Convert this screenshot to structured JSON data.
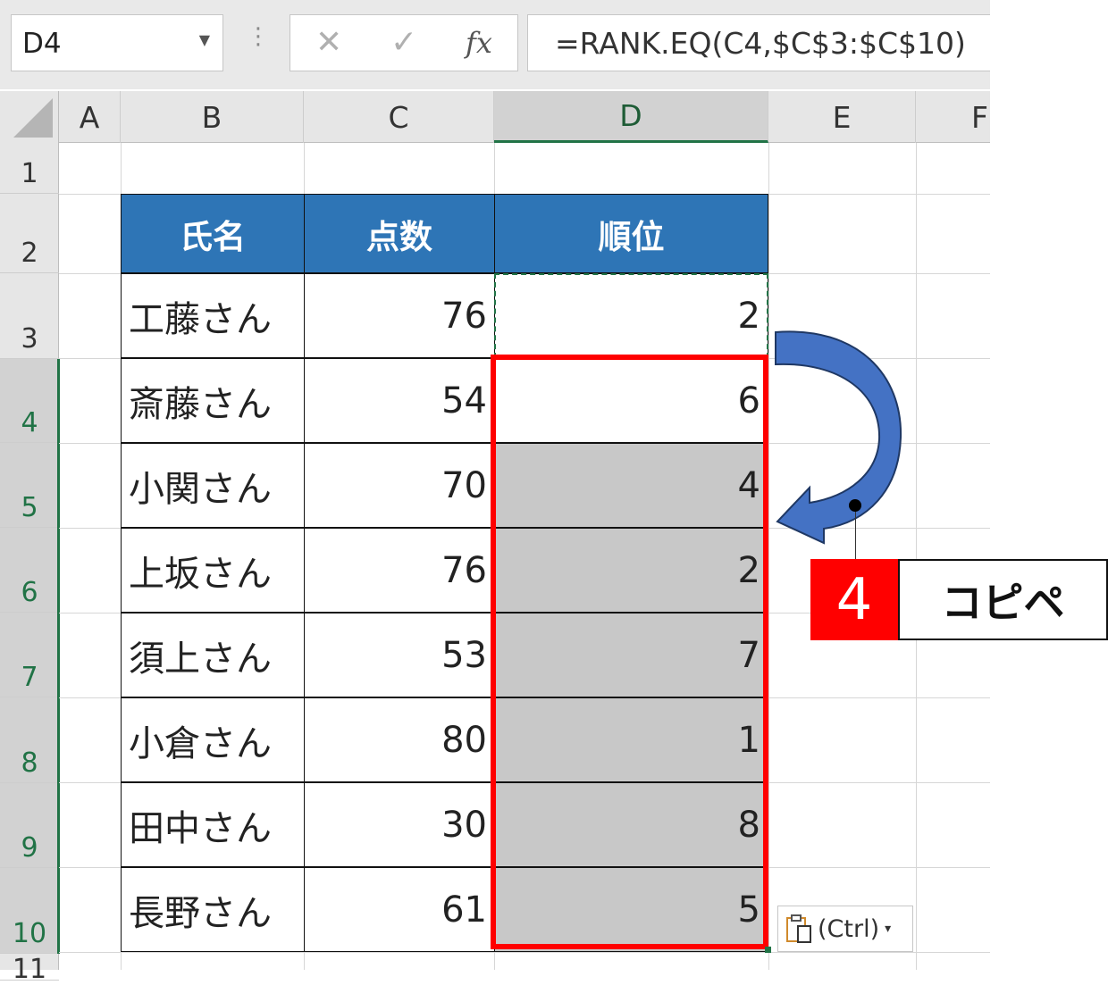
{
  "formula_bar": {
    "name_box": "D4",
    "name_box_dropdown_icon": "chevron-down-icon",
    "separator": "⋮",
    "cancel_icon": "✕",
    "enter_icon": "✓",
    "fx_label": "fx",
    "formula": "=RANK.EQ(C4,$C$3:$C$10)"
  },
  "columns": [
    "A",
    "B",
    "C",
    "D",
    "E",
    "F"
  ],
  "selected_column": "D",
  "rows": [
    "1",
    "2",
    "3",
    "4",
    "5",
    "6",
    "7",
    "8",
    "9",
    "10",
    "11"
  ],
  "table": {
    "headers": [
      "氏名",
      "点数",
      "順位"
    ],
    "header_color": "#2e75b6",
    "rows": [
      {
        "name": "工藤さん",
        "score": "76",
        "rank": "2"
      },
      {
        "name": "斎藤さん",
        "score": "54",
        "rank": "6"
      },
      {
        "name": "小関さん",
        "score": "70",
        "rank": "4"
      },
      {
        "name": "上坂さん",
        "score": "76",
        "rank": "2"
      },
      {
        "name": "須上さん",
        "score": "53",
        "rank": "7"
      },
      {
        "name": "小倉さん",
        "score": "80",
        "rank": "1"
      },
      {
        "name": "田中さん",
        "score": "30",
        "rank": "8"
      },
      {
        "name": "長野さん",
        "score": "61",
        "rank": "5"
      }
    ]
  },
  "callout": {
    "step_number": "4",
    "label": "コピペ",
    "step_color": "#ff0000",
    "arrow_color": "#4472c4"
  },
  "paste_options": {
    "label": "(Ctrl)",
    "icon": "clipboard-icon",
    "dropdown": "▾"
  },
  "highlight_color": "#ff0000",
  "selection_color": "#217346"
}
